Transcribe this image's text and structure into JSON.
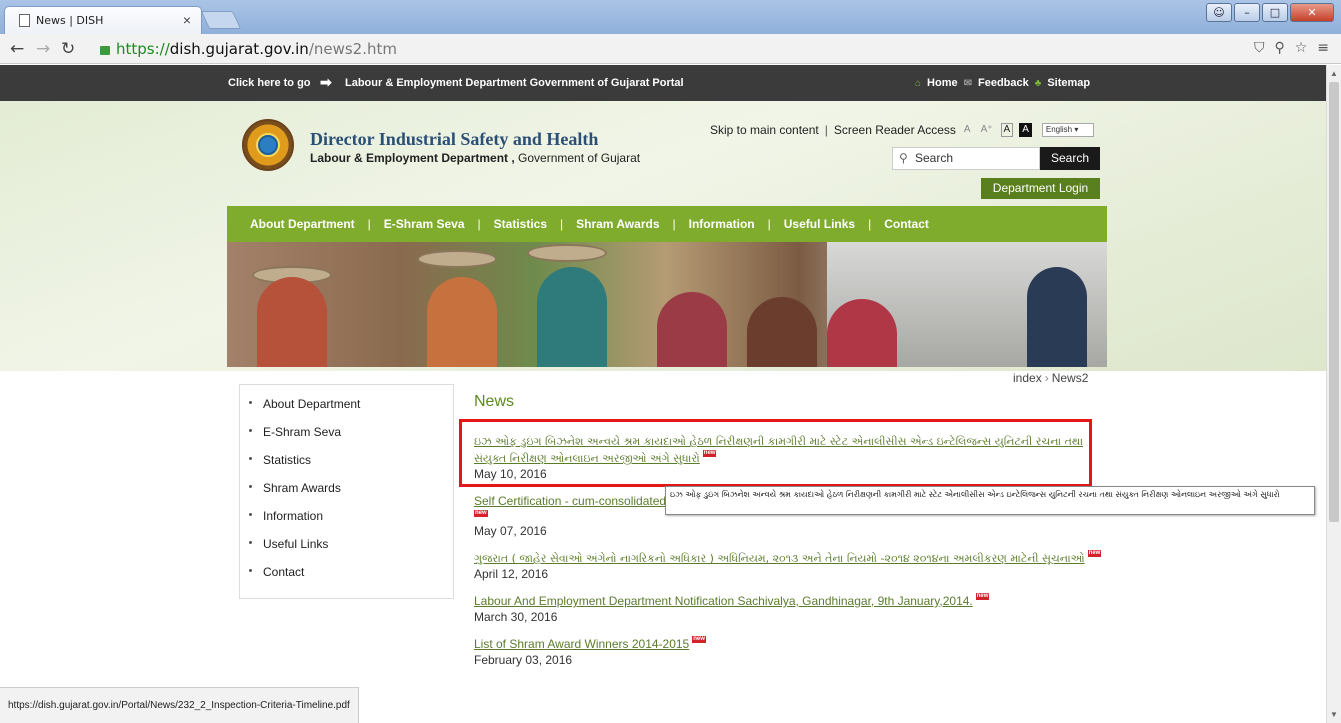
{
  "browser": {
    "tab_title": "News | DISH",
    "tab_close": "×",
    "url_scheme": "https://",
    "url_host": "dish.gujarat.gov.in",
    "url_path": "/news2.htm",
    "status_url": "https://dish.gujarat.gov.in/Portal/News/232_2_Inspection-Criteria-Timeline.pdf"
  },
  "topbar": {
    "goto_label": "Click here to go",
    "portal_link": "Labour & Employment Department Government of Gujarat Portal",
    "home": "Home",
    "feedback": "Feedback",
    "sitemap": "Sitemap"
  },
  "header": {
    "title": "Director Industrial Safety and Health",
    "subtitle_bold": "Labour & Employment Department ,",
    "subtitle_rest": " Government of Gujarat",
    "skip_link": "Skip to main content",
    "screen_reader": "Screen Reader Access",
    "font_small": "A",
    "font_large": "A⁺",
    "contrast_a": "A",
    "contrast_b": "A",
    "language": "English",
    "search_placeholder": "Search",
    "search_button": "Search",
    "login_button": "Department Login"
  },
  "nav": {
    "items": [
      "About Department",
      "E-Shram Seva",
      "Statistics",
      "Shram Awards",
      "Information",
      "Useful Links",
      "Contact"
    ]
  },
  "breadcrumb": {
    "parent": "index",
    "current": "News2"
  },
  "sidebar": {
    "items": [
      "About Department",
      "E-Shram Seva",
      "Statistics",
      "Shram Awards",
      "Information",
      "Useful Links",
      "Contact"
    ]
  },
  "news": {
    "heading": "News",
    "badge": "new",
    "items": [
      {
        "title": "ઇઝ ઓફ ડુઇંગ બિઝનેશ અન્વયે શ્રમ કાયદાઓ હેઠળ નિરીક્ષણની કામગીરી માટે સ્ટેટ એનાલીસીસ એન્ડ ઇન્ટેલિજન્સ યુનિટની રચના તથા સંયુક્ત નિરીક્ષણ ઓનલાઇન અરજીઓ અંગે સુધારો",
        "date": "May 10, 2016",
        "guj": true
      },
      {
        "title": "Self Certification - cum-consolidated",
        "date": "May 07, 2016",
        "guj": false
      },
      {
        "title": "ગુજરાત ( જાહેર સેવાઓ અંગેનો નાગરિકનો અધિકાર ) અધિનિયમ, ૨૦૧૩ અને તેના નિયમો -૨૦૧૪ ૨૦૧૪ના અમલીકરણ માટેની સૂચનાઓ",
        "date": "April 12, 2016",
        "guj": true
      },
      {
        "title": "Labour And Employment Department Notification Sachivalya, Gandhinagar, 9th January,2014.",
        "date": "March 30, 2016",
        "guj": false
      },
      {
        "title": "List of Shram Award Winners 2014-2015",
        "date": "February 03, 2016",
        "guj": false
      }
    ],
    "tooltip": "ઇઝ ઓફ ડુઇંગ બિઝનેશ અન્વયે શ્રમ કાયદાઓ હેઠળ નિરીક્ષણની કામગીરી માટે સ્ટેટ એનાલીસીસ એન્ડ ઇન્ટેલિજન્સ યુનિટની રચના તથા સંયુક્ત નિરીક્ષણ ઓનલાઇન અરજીઓ અંગે સુધારો"
  }
}
